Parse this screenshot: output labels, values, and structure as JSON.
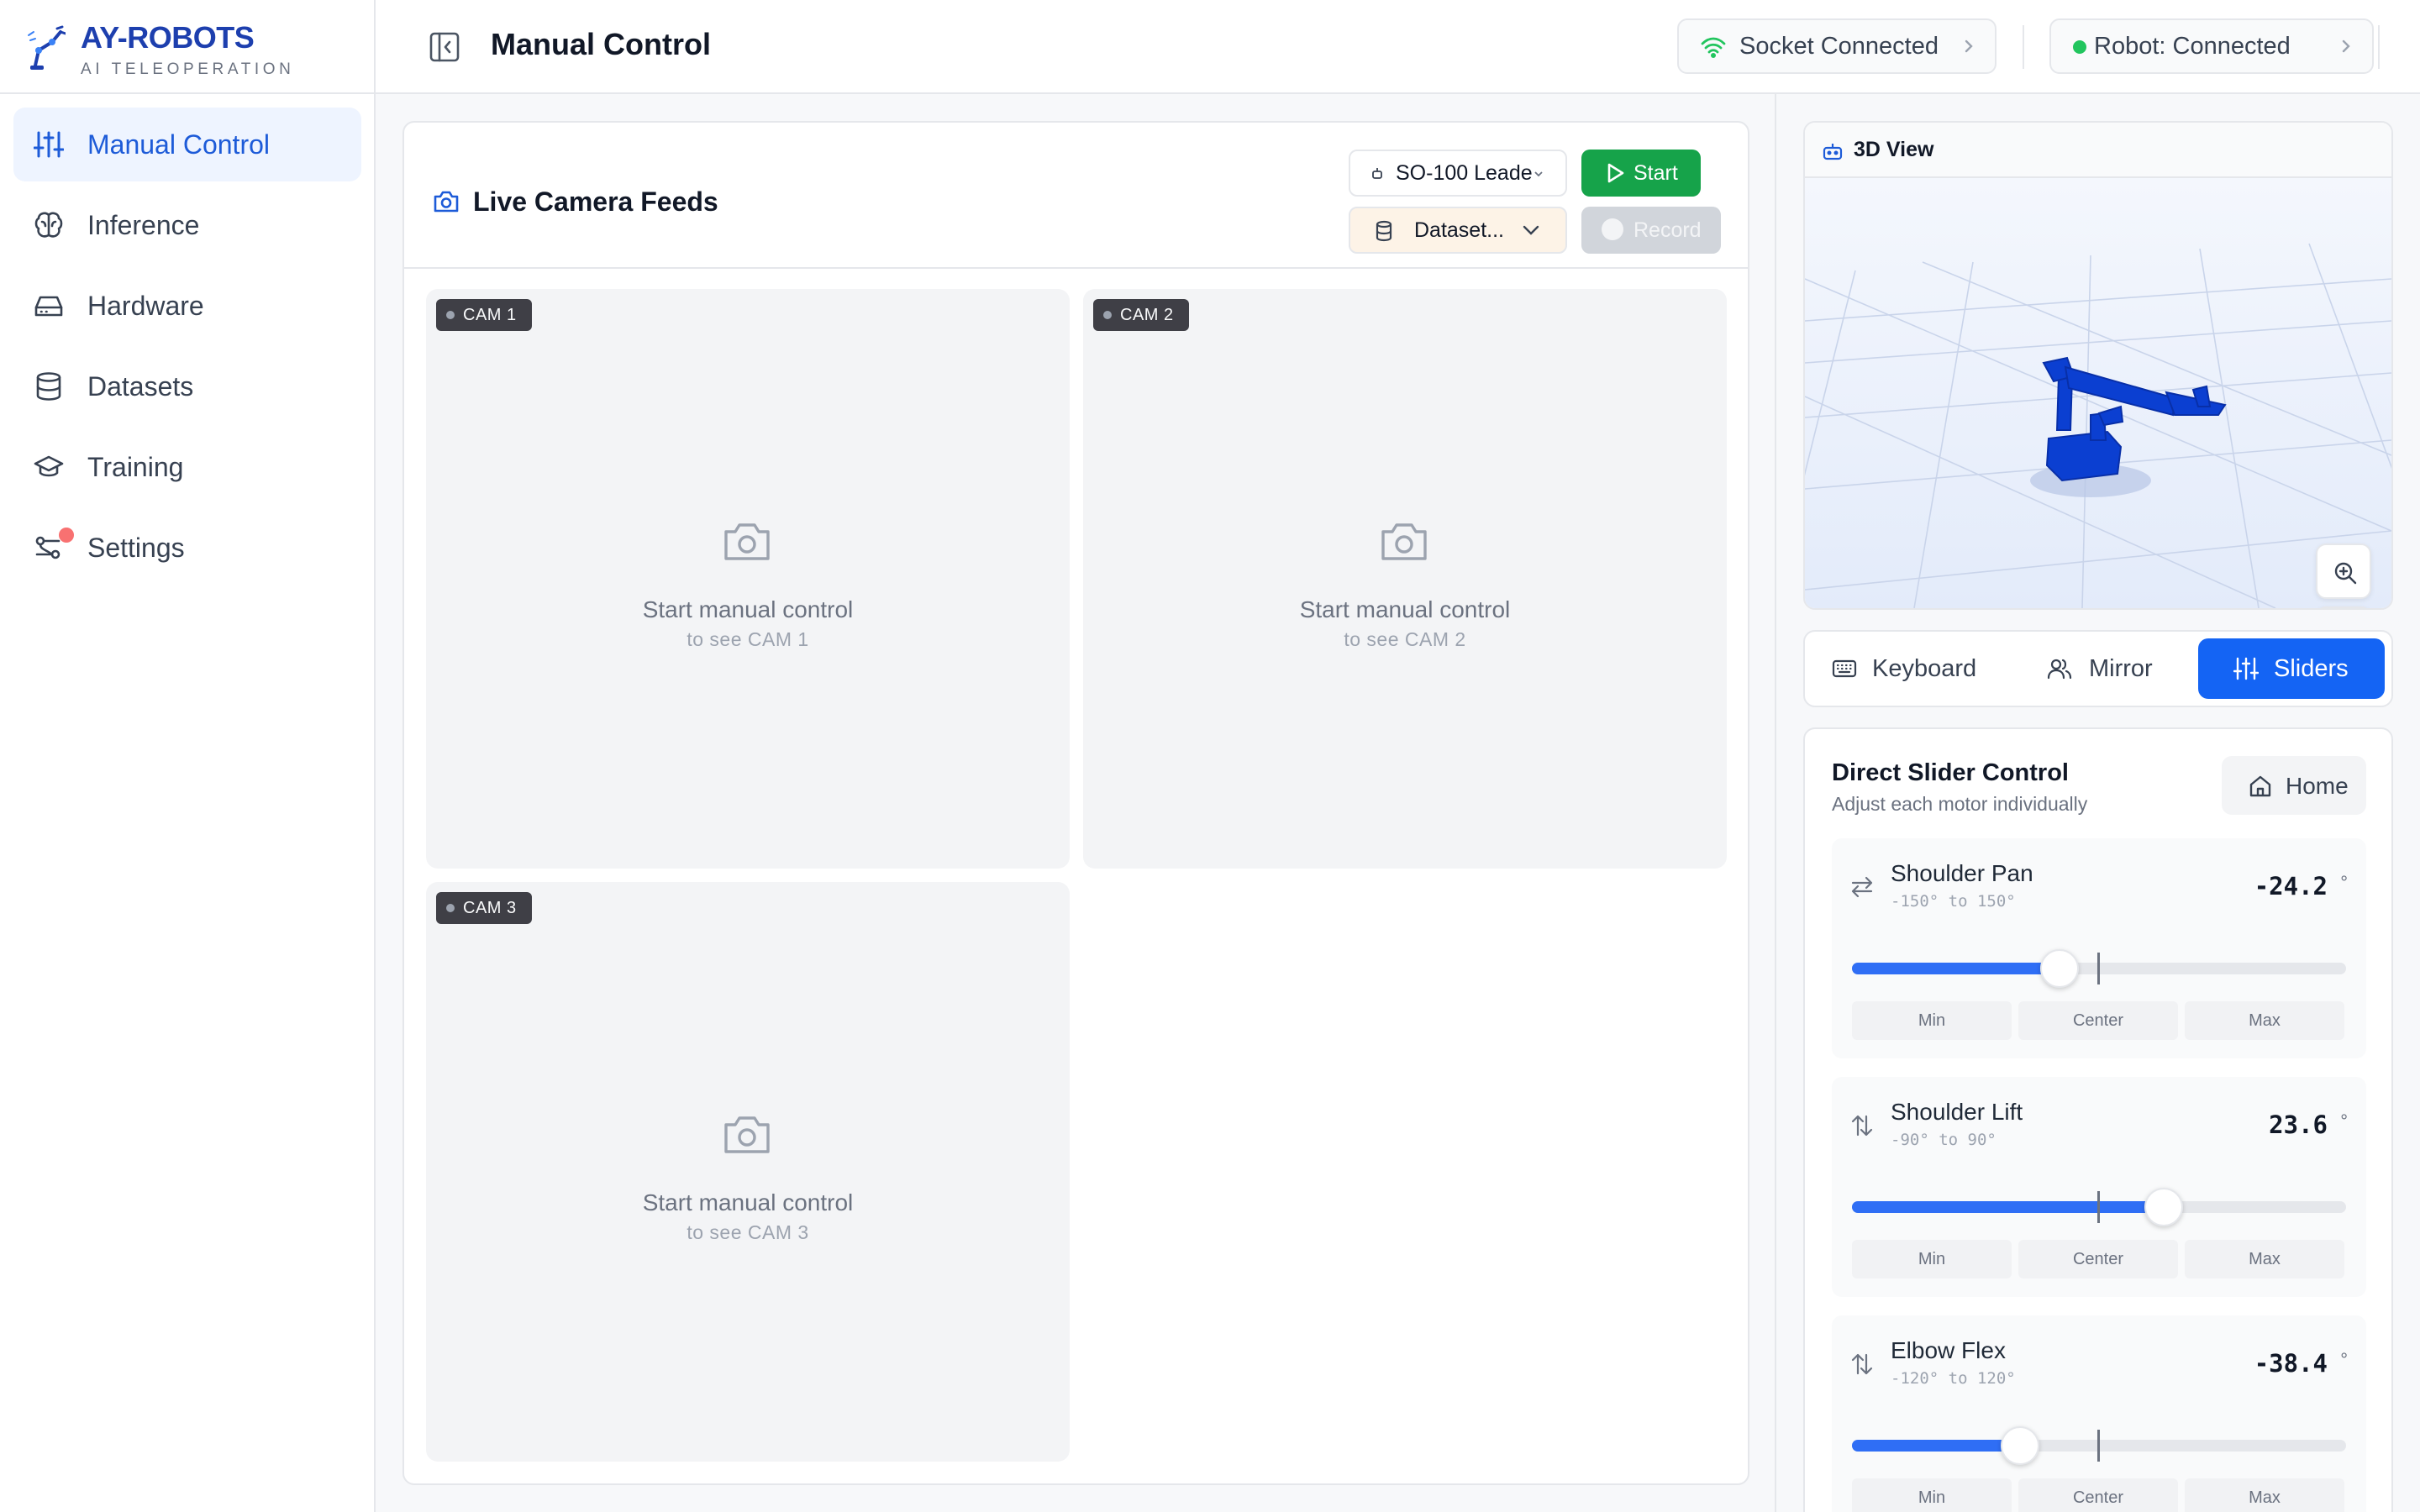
{
  "brand": {
    "title": "AY-ROBOTS",
    "subtitle": "AI TELEOPERATION"
  },
  "sidebar": {
    "items": [
      {
        "label": "Manual Control",
        "icon": "sliders-icon",
        "active": true
      },
      {
        "label": "Inference",
        "icon": "brain-icon"
      },
      {
        "label": "Hardware",
        "icon": "hard-drive-icon"
      },
      {
        "label": "Datasets",
        "icon": "database-icon"
      },
      {
        "label": "Training",
        "icon": "graduation-cap-icon"
      },
      {
        "label": "Settings",
        "icon": "settings-icon",
        "notification": true
      }
    ]
  },
  "header": {
    "title": "Manual Control",
    "socket_status": "Socket Connected",
    "robot_status": "Robot: Connected"
  },
  "camera_panel": {
    "title": "Live Camera Feeds",
    "leader_select": "SO-100 Leade",
    "start_label": "Start",
    "dataset_select": "Dataset...",
    "record_label": "Record",
    "cameras": [
      {
        "badge": "CAM 1",
        "line1": "Start manual control",
        "line2": "to see CAM 1"
      },
      {
        "badge": "CAM 2",
        "line1": "Start manual control",
        "line2": "to see CAM 2"
      },
      {
        "badge": "CAM 3",
        "line1": "Start manual control",
        "line2": "to see CAM 3"
      }
    ]
  },
  "view3d": {
    "title": "3D View"
  },
  "tabs": [
    {
      "label": "Keyboard"
    },
    {
      "label": "Mirror"
    },
    {
      "label": "Sliders",
      "active": true
    }
  ],
  "slider_control": {
    "title": "Direct Slider Control",
    "subtitle": "Adjust each motor individually",
    "home_label": "Home",
    "degree_symbol": "°",
    "buttons": {
      "min": "Min",
      "center": "Center",
      "max": "Max"
    },
    "motors": [
      {
        "name": "Shoulder Pan",
        "range": "-150° to 150°",
        "value": "-24.2",
        "min": -150,
        "max": 150,
        "current": -24.2,
        "icon": "arrows-left-right-icon"
      },
      {
        "name": "Shoulder Lift",
        "range": "-90° to 90°",
        "value": "23.6",
        "min": -90,
        "max": 90,
        "current": 23.6,
        "icon": "arrows-up-down-icon"
      },
      {
        "name": "Elbow Flex",
        "range": "-120° to 120°",
        "value": "-38.4",
        "min": -120,
        "max": 120,
        "current": -38.4,
        "icon": "arrows-up-down-icon"
      }
    ]
  },
  "colors": {
    "accent": "#1464f4",
    "brand": "#1d3fae",
    "success": "#16a34a",
    "robot_model": "#0b3fd1"
  }
}
